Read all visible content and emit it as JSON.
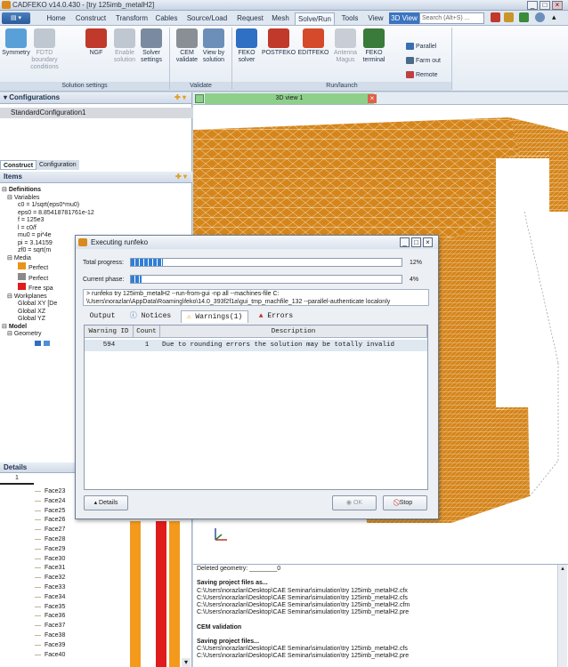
{
  "window": {
    "title": "CADFEKO v14.0.430 - [try 125imb_metalH2]",
    "min": "_",
    "max": "□",
    "close": "×"
  },
  "ribbon_tabs": [
    "Home",
    "Construct",
    "Transform",
    "Cables",
    "Source/Load",
    "Request",
    "Mesh",
    "Solve/Run",
    "Tools",
    "View",
    "Display options"
  ],
  "active_tab": "Solve/Run",
  "view3d_badge": "3D View",
  "search_placeholder": "Search (Alt+S) ...",
  "ribbon": {
    "solution_settings": [
      {
        "label1": "Symmetry",
        "label2": "",
        "disabled": false,
        "color": "#5aa0d8"
      },
      {
        "label1": "FDTD boundary",
        "label2": "conditions",
        "disabled": true,
        "color": "#bfc7d1"
      },
      {
        "label1": "NGF",
        "label2": "",
        "disabled": false,
        "color": "#c0392b"
      },
      {
        "label1": "Enable",
        "label2": "solution",
        "disabled": true,
        "color": "#bfc7d1"
      },
      {
        "label1": "Solver",
        "label2": "settings",
        "disabled": false,
        "color": "#7a8aa0"
      }
    ],
    "validate": [
      {
        "label1": "CEM",
        "label2": "validate",
        "disabled": false,
        "color": "#8a8f96"
      },
      {
        "label1": "View by",
        "label2": "solution",
        "disabled": false,
        "color": "#6b8fb8"
      }
    ],
    "run_launch": [
      {
        "label1": "FEKO",
        "label2": "solver",
        "disabled": false,
        "color": "#2f6fc4"
      },
      {
        "label1": "POSTFEKO",
        "label2": "",
        "disabled": false,
        "color": "#c0392b"
      },
      {
        "label1": "EDITFEKO",
        "label2": "",
        "disabled": false,
        "color": "#d44a2a"
      },
      {
        "label1": "Antenna",
        "label2": "Magus",
        "disabled": true,
        "color": "#c9ced6"
      },
      {
        "label1": "FEKO",
        "label2": "terminal",
        "disabled": false,
        "color": "#3a7a3a"
      }
    ],
    "small_buttons": [
      "Parallel",
      "Farm out",
      "Remote"
    ],
    "group_labels": {
      "solution_settings": "Solution settings",
      "validate": "Validate",
      "run_launch": "Run/launch"
    }
  },
  "configurations": {
    "header": "Configurations",
    "item": "StandardConfiguration1"
  },
  "tree": {
    "tabs": [
      "Construct",
      "Configuration"
    ],
    "active_tab": "Construct",
    "header": "Items",
    "lines": [
      {
        "indent": 0,
        "text": "Definitions",
        "bold": true,
        "expander": "⊟"
      },
      {
        "indent": 1,
        "text": "Variables",
        "bold": false,
        "expander": "⊟"
      },
      {
        "indent": 3,
        "text": "c0 = 1/sqrt(eps0*mu0)",
        "bold": false,
        "expander": ""
      },
      {
        "indent": 3,
        "text": "eps0 = 8.85418781761e-12",
        "bold": false,
        "expander": ""
      },
      {
        "indent": 3,
        "text": "f = 125e3",
        "bold": false,
        "expander": ""
      },
      {
        "indent": 3,
        "text": "l = c0/f",
        "bold": false,
        "expander": ""
      },
      {
        "indent": 3,
        "text": "mu0 = pi*4e",
        "bold": false,
        "expander": ""
      },
      {
        "indent": 3,
        "text": "pi = 3.14159",
        "bold": false,
        "expander": ""
      },
      {
        "indent": 3,
        "text": "zf0 = sqrt(m",
        "bold": false,
        "expander": ""
      },
      {
        "indent": 1,
        "text": "Media",
        "bold": false,
        "expander": "⊟"
      },
      {
        "indent": 3,
        "text": "Perfect",
        "bold": false,
        "expander": "",
        "swatch": "#e8941a"
      },
      {
        "indent": 3,
        "text": "Perfect",
        "bold": false,
        "expander": "",
        "swatch": "#8a8a8a"
      },
      {
        "indent": 3,
        "text": "Free spa",
        "bold": false,
        "expander": "",
        "swatch": "#e01b1b"
      },
      {
        "indent": 1,
        "text": "Workplanes",
        "bold": false,
        "expander": "⊟"
      },
      {
        "indent": 3,
        "text": "Global XY [De",
        "bold": false,
        "expander": ""
      },
      {
        "indent": 3,
        "text": "Global XZ",
        "bold": false,
        "expander": ""
      },
      {
        "indent": 3,
        "text": "Global YZ",
        "bold": false,
        "expander": ""
      },
      {
        "indent": 0,
        "text": "Model",
        "bold": true,
        "expander": "⊟"
      },
      {
        "indent": 1,
        "text": "Geometry",
        "bold": false,
        "expander": "⊟"
      }
    ]
  },
  "details": {
    "header": "Details",
    "column": "1",
    "faces": [
      "Face23",
      "Face24",
      "Face25",
      "Face26",
      "Face27",
      "Face28",
      "Face29",
      "Face30",
      "Face31",
      "Face32",
      "Face33",
      "Face34",
      "Face35",
      "Face36",
      "Face37",
      "Face38",
      "Face39",
      "Face40"
    ],
    "bar_colors": [
      "#f39a1c",
      "#e01b1b",
      "#f39a1c"
    ]
  },
  "view3d": {
    "tab_label": "3D view 1",
    "model_color": "#d5851a"
  },
  "dialog": {
    "title": "Executing runfeko",
    "total_progress_label": "Total progress:",
    "total_progress_pct": "12%",
    "total_progress": 0.12,
    "phase_label": "Current phase:",
    "phase_pct": "4%",
    "phase_progress": 0.04,
    "command_line1": "> runfeko try 125imb_metalH2 --run-from-gui -np all --machines-file C:",
    "command_line2": "\\Users\\norazlan\\AppData\\Roaming\\feko\\14.0_393f2f1a\\gui_tmp_machfile_132 --parallel-authenticate localonly",
    "tabs": [
      "Output",
      "Notices",
      "Warnings(1)",
      "Errors"
    ],
    "active_tab": "Warnings(1)",
    "columns": [
      "Warning ID",
      "Count",
      "Description"
    ],
    "rows": [
      {
        "id": "594",
        "count": "1",
        "description": "Due to rounding errors the solution may be totally invalid"
      }
    ],
    "details_button": "Details",
    "ok_button": "OK",
    "stop_button": "Stop"
  },
  "messages": [
    {
      "text": "Deleted geometry: ________0",
      "bold": false
    },
    {
      "text": "",
      "bold": false
    },
    {
      "text": "Saving project files as...",
      "bold": true
    },
    {
      "text": "C:\\Users\\norazlan\\Desktop\\CAE Seminar\\simulation\\try 125imb_metalH2.cfx",
      "bold": false
    },
    {
      "text": "C:\\Users\\norazlan\\Desktop\\CAE Seminar\\simulation\\try 125imb_metalH2.cfs",
      "bold": false
    },
    {
      "text": "C:\\Users\\norazlan\\Desktop\\CAE Seminar\\simulation\\try 125imb_metalH2.cfm",
      "bold": false
    },
    {
      "text": "C:\\Users\\norazlan\\Desktop\\CAE Seminar\\simulation\\try 125imb_metalH2.pre",
      "bold": false
    },
    {
      "text": "",
      "bold": false
    },
    {
      "text": "CEM validation",
      "bold": true
    },
    {
      "text": "",
      "bold": false
    },
    {
      "text": "Saving project files...",
      "bold": true
    },
    {
      "text": "C:\\Users\\norazlan\\Desktop\\CAE Seminar\\simulation\\try 125imb_metalH2.cfs",
      "bold": false
    },
    {
      "text": "C:\\Users\\norazlan\\Desktop\\CAE Seminar\\simulation\\try 125imb_metalH2.pre",
      "bold": false
    }
  ]
}
